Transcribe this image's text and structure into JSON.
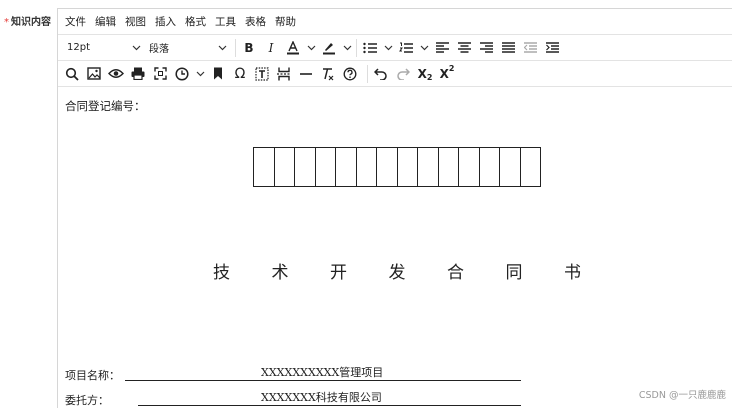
{
  "form": {
    "required_mark": "*",
    "field_label": "知识内容"
  },
  "menubar": {
    "items": [
      "文件",
      "编辑",
      "视图",
      "插入",
      "格式",
      "工具",
      "表格",
      "帮助"
    ]
  },
  "toolbar": {
    "font_size": "12pt",
    "block_format": "段落"
  },
  "document": {
    "reg_label": "合同登记编号：",
    "box_count": 14,
    "title_chars": [
      "技",
      "术",
      "开",
      "发",
      "合",
      "同",
      "书"
    ],
    "project_label": "项目名称：",
    "project_value": "XXXXXXXXXX管理项目",
    "client_label": "委托方：",
    "client_value": "XXXXXXX科技有限公司"
  },
  "watermark": "CSDN @一只鹿鹿鹿"
}
